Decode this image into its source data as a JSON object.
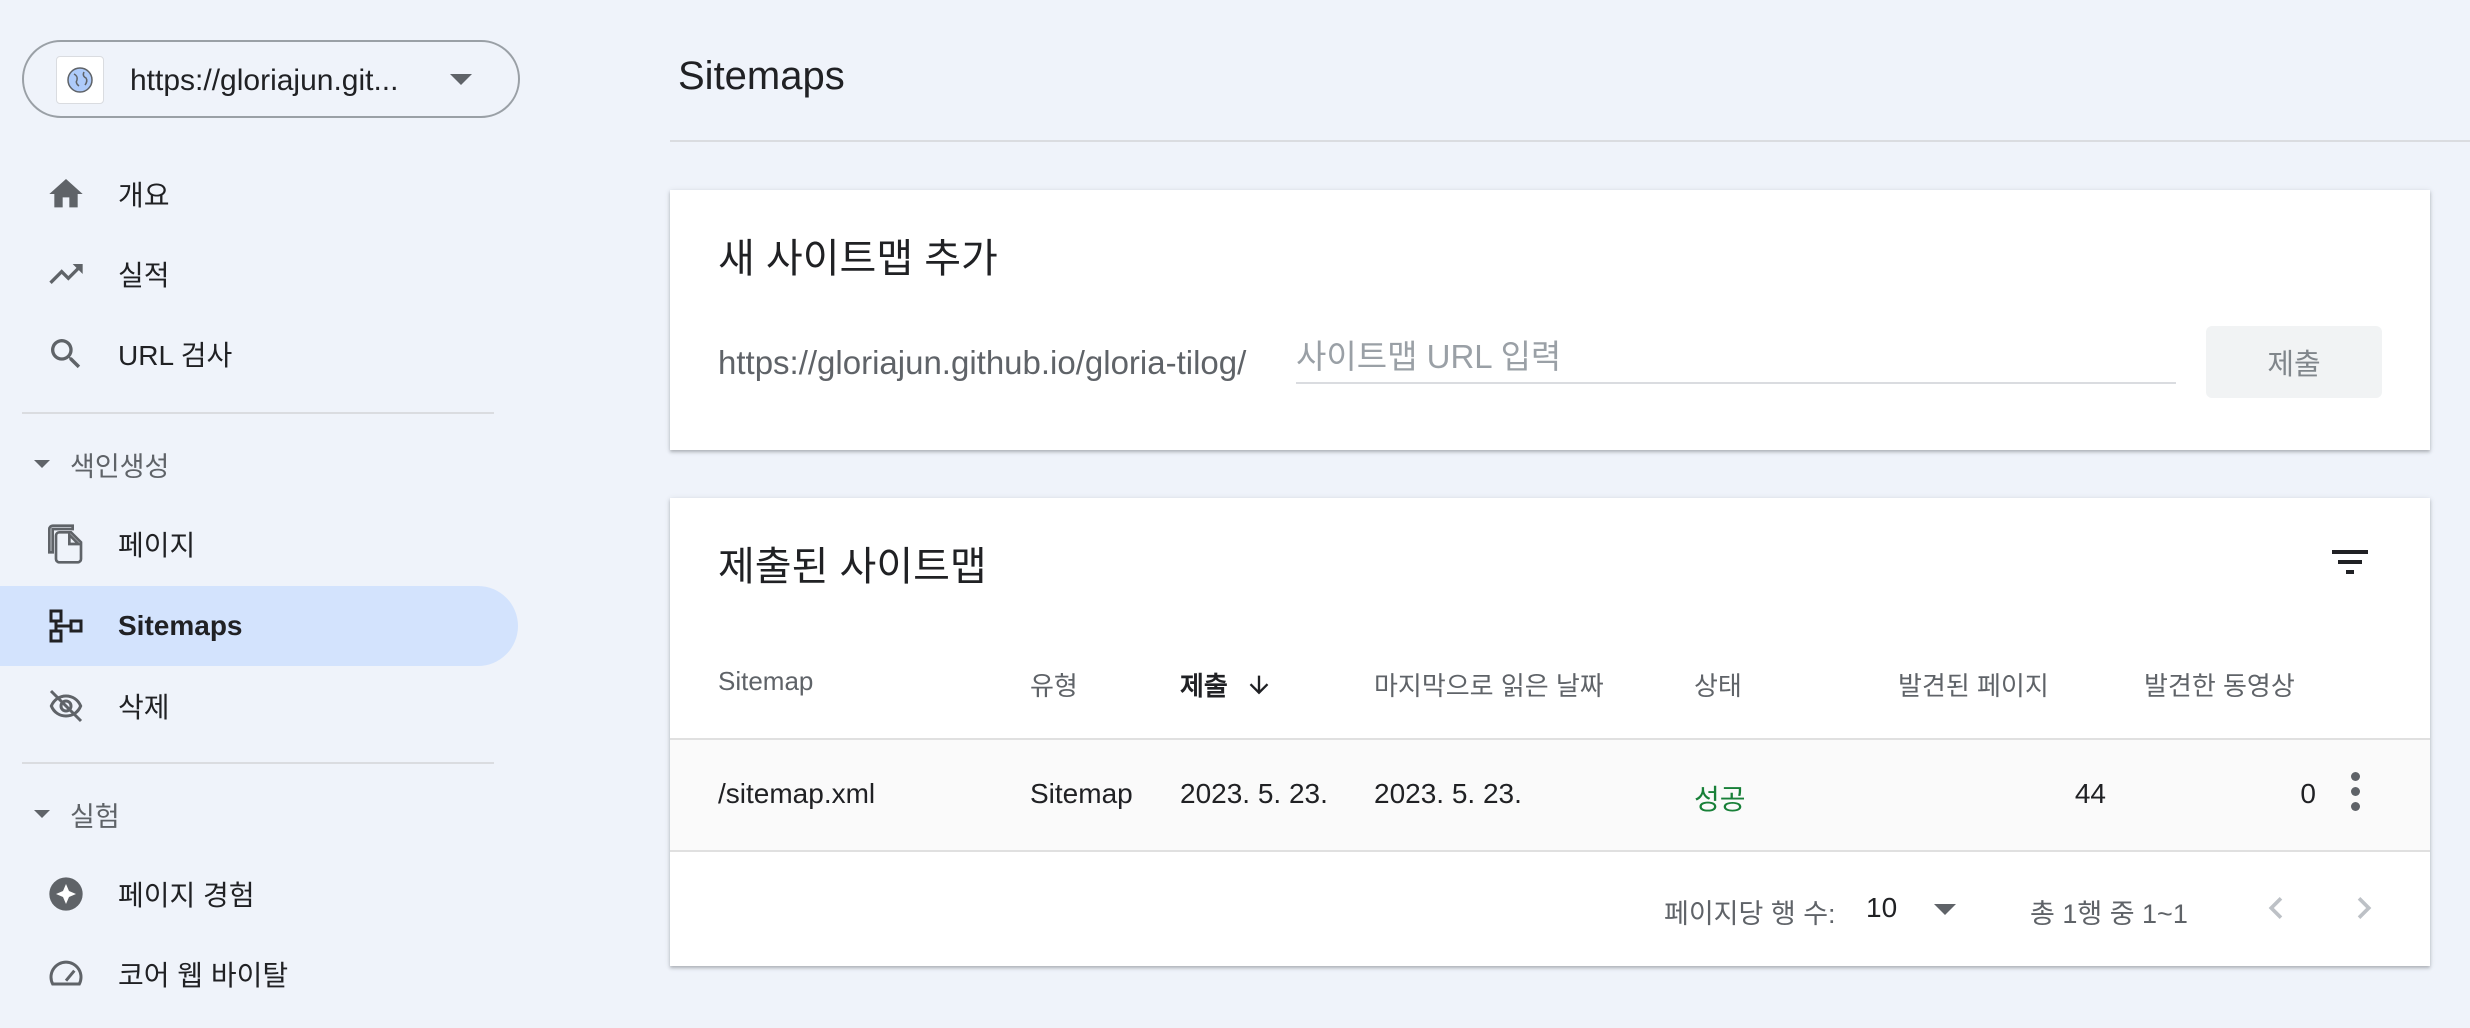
{
  "property": {
    "label": "https://gloriajun.git..."
  },
  "sidebar": {
    "items": [
      {
        "label": "개요",
        "icon": "home-icon"
      },
      {
        "label": "실적",
        "icon": "trending-up-icon"
      },
      {
        "label": "URL 검사",
        "icon": "search-icon"
      }
    ],
    "sections": [
      {
        "label": "색인생성",
        "items": [
          {
            "label": "페이지",
            "icon": "pages-icon"
          },
          {
            "label": "Sitemaps",
            "icon": "sitemap-icon",
            "active": true
          },
          {
            "label": "삭제",
            "icon": "visibility-off-icon"
          }
        ]
      },
      {
        "label": "실험",
        "items": [
          {
            "label": "페이지 경험",
            "icon": "page-experience-icon"
          },
          {
            "label": "코어 웹 바이탈",
            "icon": "speed-gauge-icon"
          }
        ]
      }
    ]
  },
  "page": {
    "title": "Sitemaps"
  },
  "add_card": {
    "title": "새 사이트맵 추가",
    "url_prefix": "https://gloriajun.github.io/gloria-tilog/",
    "input_placeholder": "사이트맵 URL 입력",
    "input_value": "",
    "submit_label": "제출"
  },
  "list_card": {
    "title": "제출된 사이트맵",
    "columns": [
      "Sitemap",
      "유형",
      "제출",
      "마지막으로 읽은 날짜",
      "상태",
      "발견된 페이지",
      "발견한 동영상"
    ],
    "sorted_column": "제출",
    "rows": [
      {
        "sitemap": "/sitemap.xml",
        "type": "Sitemap",
        "submitted": "2023. 5. 23.",
        "last_read": "2023. 5. 23.",
        "status": "성공",
        "pages": "44",
        "videos": "0"
      }
    ],
    "pagination": {
      "rows_per_page_label": "페이지당 행 수:",
      "rows_per_page": "10",
      "range_label": "총 1행 중 1~1"
    }
  },
  "colors": {
    "background": "#eff3fa",
    "active_nav": "#d3e3fd",
    "success": "#188038",
    "secondary_text": "#5f6368"
  }
}
